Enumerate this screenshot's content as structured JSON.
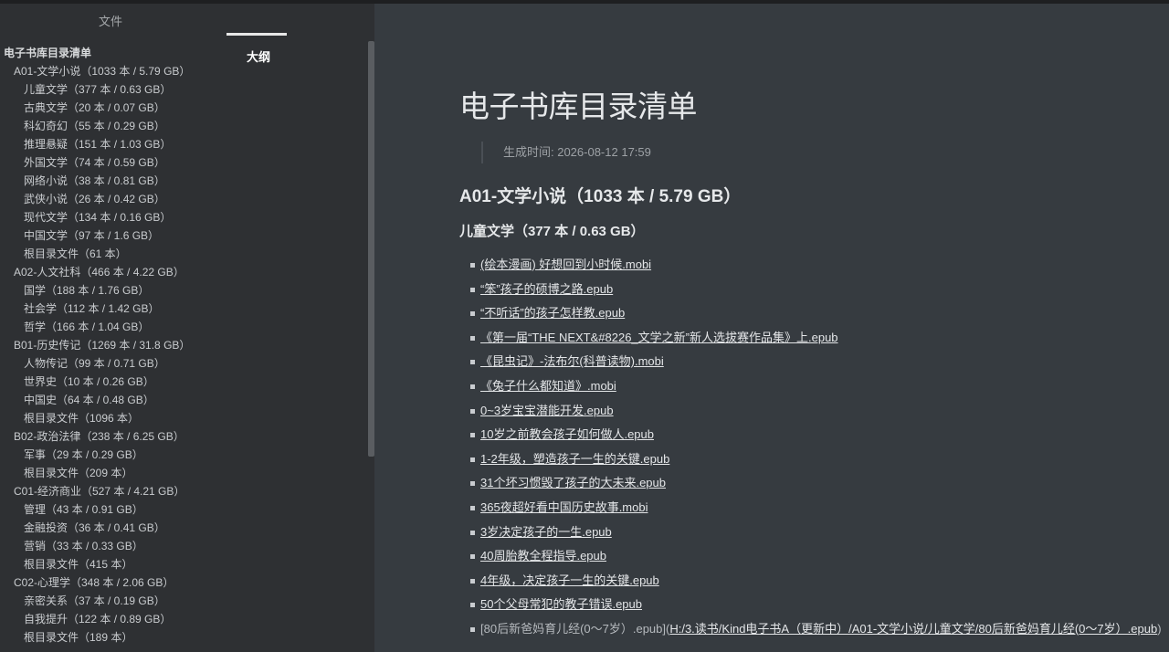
{
  "sidebar": {
    "tabs": {
      "files": "文件",
      "outline": "大纲"
    },
    "outline": [
      {
        "level": 1,
        "label": "电子书库目录清单"
      },
      {
        "level": 2,
        "label": "A01-文学小说（1033 本 / 5.79 GB）"
      },
      {
        "level": 3,
        "label": "儿童文学（377 本 / 0.63 GB）"
      },
      {
        "level": 3,
        "label": "古典文学（20 本 / 0.07 GB）"
      },
      {
        "level": 3,
        "label": "科幻奇幻（55 本 / 0.29 GB）"
      },
      {
        "level": 3,
        "label": "推理悬疑（151 本 / 1.03 GB）"
      },
      {
        "level": 3,
        "label": "外国文学（74 本 / 0.59 GB）"
      },
      {
        "level": 3,
        "label": "网络小说（38 本 / 0.81 GB）"
      },
      {
        "level": 3,
        "label": "武侠小说（26 本 / 0.42 GB）"
      },
      {
        "level": 3,
        "label": "现代文学（134 本 / 0.16 GB）"
      },
      {
        "level": 3,
        "label": "中国文学（97 本 / 1.6 GB）"
      },
      {
        "level": 3,
        "label": "根目录文件（61 本）"
      },
      {
        "level": 2,
        "label": "A02-人文社科（466 本 / 4.22 GB）"
      },
      {
        "level": 3,
        "label": "国学（188 本 / 1.76 GB）"
      },
      {
        "level": 3,
        "label": "社会学（112 本 / 1.42 GB）"
      },
      {
        "level": 3,
        "label": "哲学（166 本 / 1.04 GB）"
      },
      {
        "level": 2,
        "label": "B01-历史传记（1269 本 / 31.8 GB）"
      },
      {
        "level": 3,
        "label": "人物传记（99 本 / 0.71 GB）"
      },
      {
        "level": 3,
        "label": "世界史（10 本 / 0.26 GB）"
      },
      {
        "level": 3,
        "label": "中国史（64 本 / 0.48 GB）"
      },
      {
        "level": 3,
        "label": "根目录文件（1096 本）"
      },
      {
        "level": 2,
        "label": "B02-政治法律（238 本 / 6.25 GB）"
      },
      {
        "level": 3,
        "label": "军事（29 本 / 0.29 GB）"
      },
      {
        "level": 3,
        "label": "根目录文件（209 本）"
      },
      {
        "level": 2,
        "label": "C01-经济商业（527 本 / 4.21 GB）"
      },
      {
        "level": 3,
        "label": "管理（43 本 / 0.91 GB）"
      },
      {
        "level": 3,
        "label": "金融投资（36 本 / 0.41 GB）"
      },
      {
        "level": 3,
        "label": "营销（33 本 / 0.33 GB）"
      },
      {
        "level": 3,
        "label": "根目录文件（415 本）"
      },
      {
        "level": 2,
        "label": "C02-心理学（348 本 / 2.06 GB）"
      },
      {
        "level": 3,
        "label": "亲密关系（37 本 / 0.19 GB）"
      },
      {
        "level": 3,
        "label": "自我提升（122 本 / 0.89 GB）"
      },
      {
        "level": 3,
        "label": "根目录文件（189 本）"
      }
    ]
  },
  "main": {
    "title": "电子书库目录清单",
    "generated": "生成时间: 2026-08-12 17:59",
    "section": "A01-文学小说（1033 本 / 5.79 GB）",
    "subsection": "儿童文学（377 本 / 0.63 GB）",
    "files": [
      {
        "text": "(绘本漫画) 好想回到小时候.mobi"
      },
      {
        "text": "“笨”孩子的硕博之路.epub"
      },
      {
        "text": "“不听话”的孩子怎样教.epub"
      },
      {
        "text": "《第一届“THE NEXT&#8226_文学之新”新人选拔赛作品集》上.epub"
      },
      {
        "text": "《昆虫记》-法布尔(科普读物).mobi"
      },
      {
        "text": "《兔子什么都知道》.mobi"
      },
      {
        "text": "0~3岁宝宝潜能开发.epub"
      },
      {
        "text": "10岁之前教会孩子如何做人.epub"
      },
      {
        "text": "1-2年级，塑造孩子一生的关键.epub"
      },
      {
        "text": "31个坏习惯毁了孩子的大未来.epub"
      },
      {
        "text": "365夜超好看中国历史故事.mobi"
      },
      {
        "text": "3岁决定孩子的一生.epub"
      },
      {
        "text": "40周胎教全程指导.epub"
      },
      {
        "text": "4年级，决定孩子一生的关键.epub"
      },
      {
        "text": "50个父母常犯的教子错误.epub"
      },
      {
        "prefix": "[80后新爸妈育儿经(0～7岁）.epub](",
        "text": "H:/3.读书/Kind电子书A（更新中）/A01-文学小说/儿童文学/80后新爸妈育儿经(0～7岁）.epub",
        "suffix": ")"
      }
    ]
  }
}
